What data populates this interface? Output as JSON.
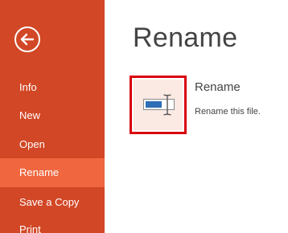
{
  "sidebar": {
    "back_icon": "back-arrow-icon",
    "items": [
      {
        "label": "Info"
      },
      {
        "label": "New"
      },
      {
        "label": "Open"
      },
      {
        "label": "Rename"
      },
      {
        "label": "Save a Copy"
      },
      {
        "label": "Print"
      }
    ],
    "active_item": "Rename"
  },
  "main": {
    "title": "Rename",
    "rename_option": {
      "icon": "rename-icon",
      "heading": "Rename",
      "description": "Rename this file."
    }
  },
  "colors": {
    "sidebar_background": "#d24726",
    "active_item_background": "#f0673f",
    "highlight_border": "#d8000c",
    "tile_background": "#fbe9e3",
    "text": "#444444"
  }
}
